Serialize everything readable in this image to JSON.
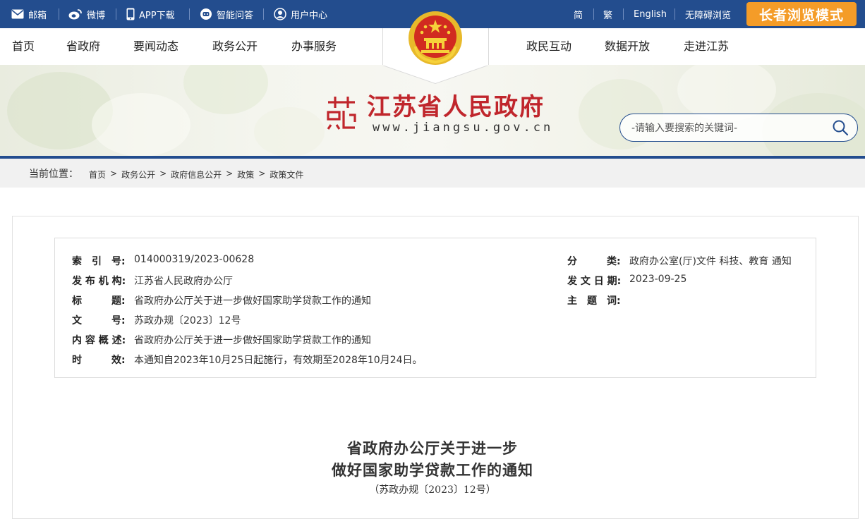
{
  "topbar": {
    "mail": "邮箱",
    "weibo": "微博",
    "app": "APP下载",
    "qa": "智能问答",
    "user": "用户中心",
    "simplified": "简",
    "traditional": "繁",
    "english": "English",
    "accessible": "无障碍浏览",
    "elder_mode": "长者浏览模式"
  },
  "nav": {
    "left": [
      "首页",
      "省政府",
      "要闻动态",
      "政务公开",
      "办事服务"
    ],
    "right": [
      "政民互动",
      "数据开放",
      "走进江苏"
    ]
  },
  "banner": {
    "title": "江苏省人民政府",
    "url": "www.jiangsu.gov.cn",
    "search_placeholder": "-请输入要搜索的关键词-"
  },
  "breadcrumb": {
    "label": "当前位置：",
    "items": [
      "首页",
      "政务公开",
      "政府信息公开",
      "政策",
      "政策文件"
    ]
  },
  "meta": {
    "index_label": "索　引　号:",
    "index_value": "014000319/2023-00628",
    "category_label": "分　　　类:",
    "category_value": "政府办公室(厅)文件 科技、教育 通知",
    "publisher_label": "发 布 机 构:",
    "publisher_value": "江苏省人民政府办公厅",
    "date_label": "发 文 日 期:",
    "date_value": "2023-09-25",
    "title_label": "标　　　题:",
    "title_value": "省政府办公厅关于进一步做好国家助学贷款工作的通知",
    "topic_label": "主　题　词:",
    "topic_value": "",
    "docno_label": "文　　　号:",
    "docno_value": "苏政办规〔2023〕12号",
    "summary_label": "内 容 概 述:",
    "summary_value": "省政府办公厅关于进一步做好国家助学贷款工作的通知",
    "validity_label": "时　　　效:",
    "validity_value": "本通知自2023年10月25日起施行，有效期至2028年10月24日。"
  },
  "document": {
    "title_line1": "省政府办公厅关于进一步",
    "title_line2": "做好国家助学贷款工作的通知",
    "number": "（苏政办规〔2023〕12号）"
  },
  "colors": {
    "primary": "#234d8e",
    "elder_button": "#f49c28",
    "title_red": "#c0262c"
  }
}
